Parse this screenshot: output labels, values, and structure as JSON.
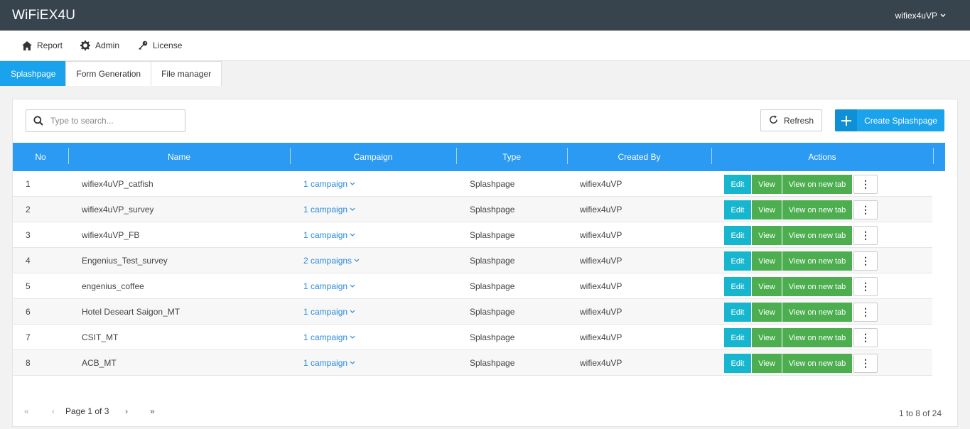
{
  "app": {
    "title": "WiFiEX4U",
    "user": "wifiex4uVP"
  },
  "nav": [
    {
      "label": "Report",
      "icon": "home-icon"
    },
    {
      "label": "Admin",
      "icon": "gear-icon"
    },
    {
      "label": "License",
      "icon": "key-icon"
    }
  ],
  "tabs": [
    {
      "label": "Splashpage",
      "active": true
    },
    {
      "label": "Form Generation",
      "active": false
    },
    {
      "label": "File manager",
      "active": false
    }
  ],
  "search": {
    "placeholder": "Type to search...",
    "value": ""
  },
  "toolbar": {
    "refresh_label": "Refresh",
    "create_label": "Create Splashpage",
    "create_icon": "plus"
  },
  "table": {
    "headers": [
      "No",
      "Name",
      "Campaign",
      "Type",
      "Created By",
      "Actions"
    ],
    "rows": [
      {
        "no": "1",
        "name": "wifiex4uVP_catfish",
        "campaign": "1 campaign",
        "type": "Splashpage",
        "created_by": "wifiex4uVP"
      },
      {
        "no": "2",
        "name": "wifiex4uVP_survey",
        "campaign": "1 campaign",
        "type": "Splashpage",
        "created_by": "wifiex4uVP"
      },
      {
        "no": "3",
        "name": "wifiex4uVP_FB",
        "campaign": "1 campaign",
        "type": "Splashpage",
        "created_by": "wifiex4uVP"
      },
      {
        "no": "4",
        "name": "Engenius_Test_survey",
        "campaign": "2 campaigns",
        "type": "Splashpage",
        "created_by": "wifiex4uVP"
      },
      {
        "no": "5",
        "name": "engenius_coffee",
        "campaign": "1 campaign",
        "type": "Splashpage",
        "created_by": "wifiex4uVP"
      },
      {
        "no": "6",
        "name": "Hotel Deseart Saigon_MT",
        "campaign": "1 campaign",
        "type": "Splashpage",
        "created_by": "wifiex4uVP"
      },
      {
        "no": "7",
        "name": "CSIT_MT",
        "campaign": "1 campaign",
        "type": "Splashpage",
        "created_by": "wifiex4uVP"
      },
      {
        "no": "8",
        "name": "ACB_MT",
        "campaign": "1 campaign",
        "type": "Splashpage",
        "created_by": "wifiex4uVP"
      }
    ],
    "action_labels": {
      "edit": "Edit",
      "view": "View",
      "view_new_tab": "View on new tab",
      "more": "⋮"
    }
  },
  "pagination": {
    "first": "«",
    "prev": "‹",
    "page_text": "Page 1 of 3",
    "next": "›",
    "last": "»",
    "range_text": "1 to 8 of 24"
  },
  "colors": {
    "topbar": "#37434d",
    "accent": "#1aa3ec",
    "header": "#2b9af3",
    "edit": "#17b6cf",
    "view": "#4cae4f"
  }
}
